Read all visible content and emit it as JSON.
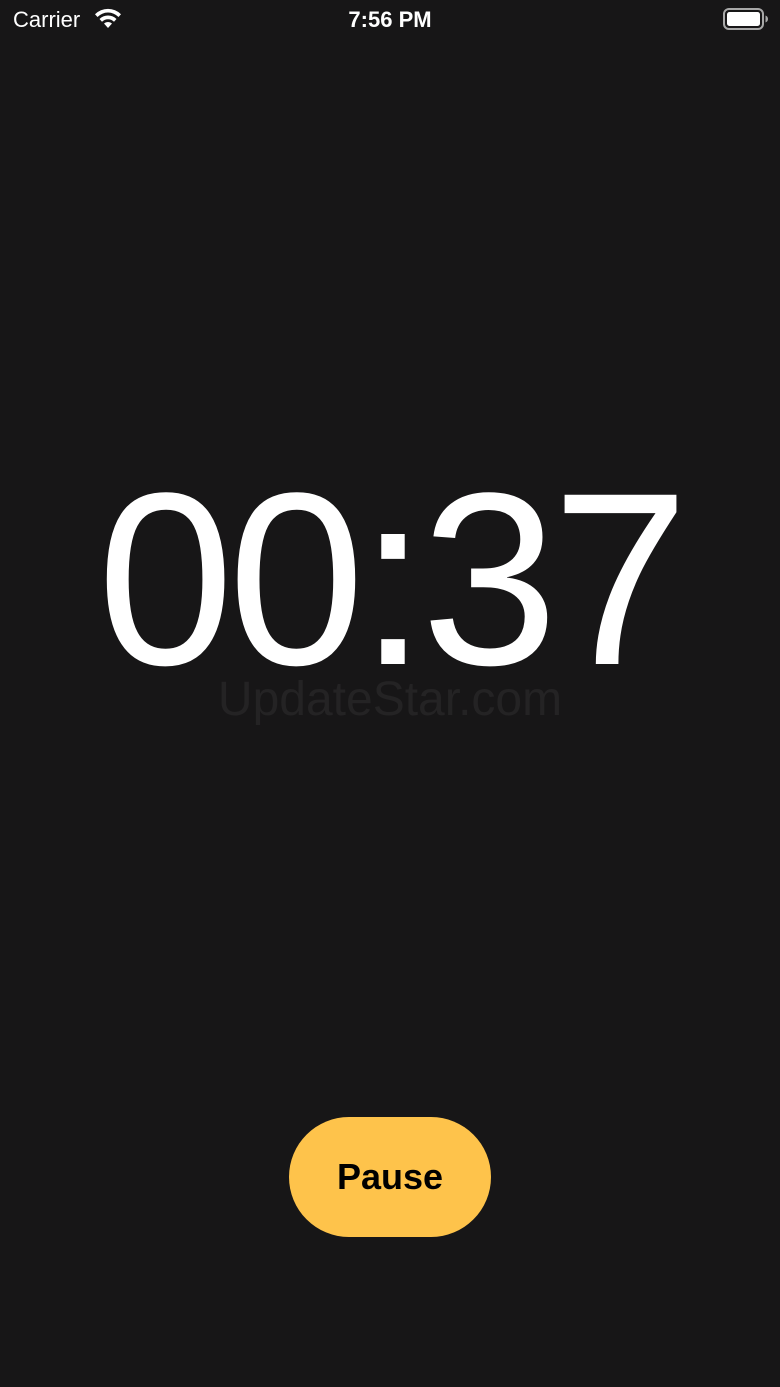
{
  "status_bar": {
    "carrier": "Carrier",
    "time": "7:56 PM",
    "icons": [
      "wifi-icon",
      "battery-icon"
    ]
  },
  "timer": {
    "display": "00:37"
  },
  "watermark": {
    "text": "UpdateStar.com"
  },
  "controls": {
    "pause_label": "Pause"
  },
  "colors": {
    "background": "#171617",
    "accent": "#fec34b",
    "text": "#ffffff"
  }
}
